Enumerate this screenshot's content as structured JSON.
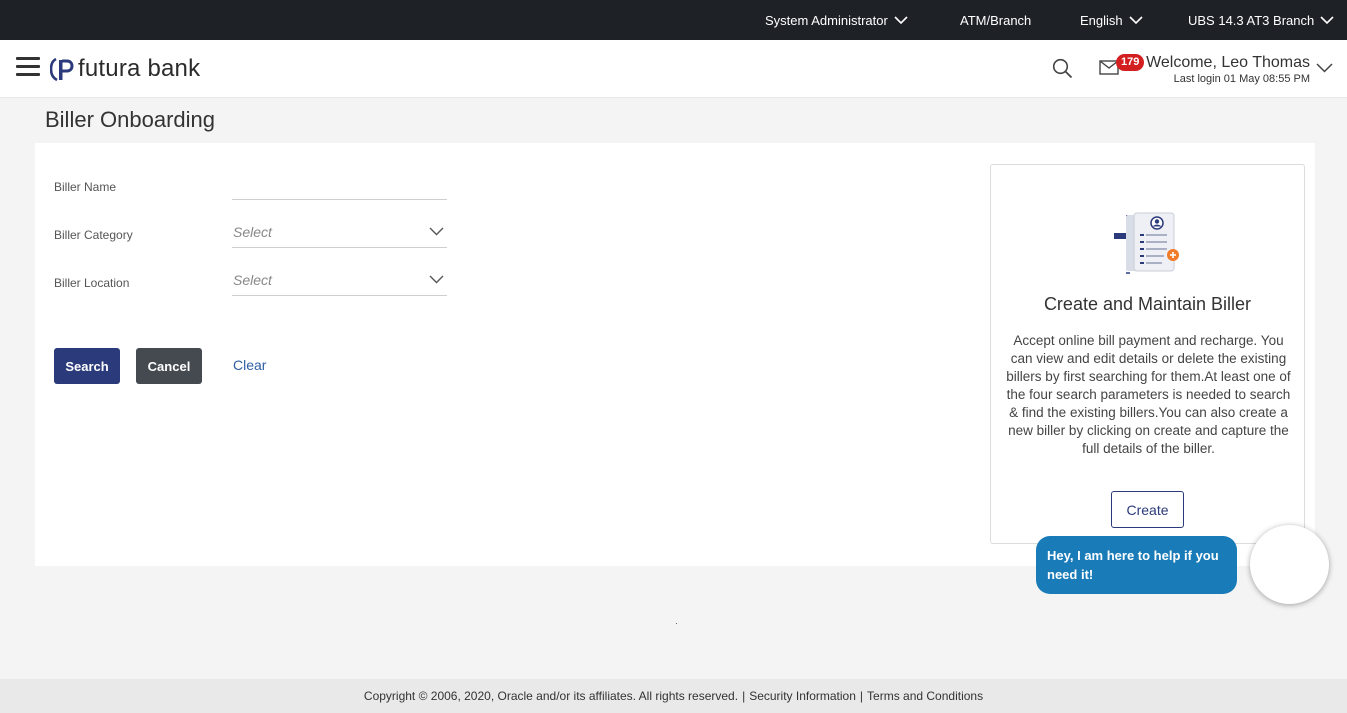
{
  "topbar": {
    "role": "System Administrator",
    "channel": "ATM/Branch",
    "language": "English",
    "branch": "UBS 14.3 AT3 Branch"
  },
  "header": {
    "brand": "futura bank",
    "notification_count": "179",
    "welcome": "Welcome, Leo Thomas",
    "last_login": "Last login 01 May 08:55 PM"
  },
  "page": {
    "title": "Biller Onboarding"
  },
  "form": {
    "biller_name_label": "Biller Name",
    "biller_name_value": "",
    "biller_category_label": "Biller Category",
    "biller_category_value": "Select",
    "biller_location_label": "Biller Location",
    "biller_location_value": "Select"
  },
  "actions": {
    "search": "Search",
    "cancel": "Cancel",
    "clear": "Clear"
  },
  "info_card": {
    "title": "Create and Maintain Biller",
    "description": "Accept online bill payment and recharge. You can view and edit details or delete the existing billers by first searching for them.At least one of the four search parameters is needed to search & find the existing billers.You can also create a new biller by clicking on create and capture the full details of the biller.",
    "create": "Create"
  },
  "chat": {
    "message": "Hey, I am here to help if you need it!"
  },
  "footer": {
    "copyright": "Copyright © 2006, 2020, Oracle and/or its affiliates. All rights reserved.",
    "security": "Security Information",
    "terms": "Terms and Conditions"
  },
  "colors": {
    "topbar_bg": "#1e2227",
    "primary": "#2b3a7a",
    "secondary_button": "#454a51",
    "link": "#2f5fa5",
    "chat_bubble": "#1a7bb9",
    "badge": "#d31f1f"
  },
  "icons": [
    "menu-icon",
    "futura-logo-icon",
    "search-icon",
    "mail-icon",
    "chevron-down-icon",
    "biller-document-icon",
    "chat-assistant-avatar"
  ]
}
